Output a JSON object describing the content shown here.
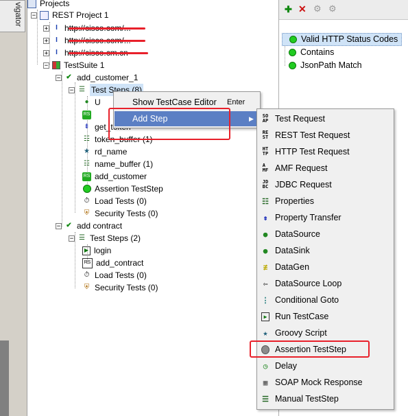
{
  "navigator_label": "vigator",
  "tree": {
    "root": "Projects",
    "project": "REST Project 1",
    "services": [
      "http://cisco.com/...",
      "http://cisco.com/...",
      "http://cisco.cm.cn"
    ],
    "suite": "TestSuite 1",
    "case1": {
      "name": "add_customer_1",
      "steps_label": "Test Steps (8)",
      "steps": [
        "U",
        "",
        "get_token",
        "token_buffer (1)",
        "rd_name",
        "name_buffer (1)",
        "add_customer",
        "Assertion TestStep"
      ],
      "load": "Load Tests (0)",
      "security": "Security Tests (0)"
    },
    "case2": {
      "name": "add contract",
      "steps_label": "Test Steps (2)",
      "steps": [
        "login",
        "add_contract"
      ],
      "load": "Load Tests (0)",
      "security": "Security Tests (0)"
    }
  },
  "context_menu": {
    "items": [
      {
        "label": "Show TestCase Editor",
        "shortcut": "Enter"
      },
      {
        "label": "Add Step",
        "shortcut": ""
      }
    ]
  },
  "submenu": {
    "items": [
      {
        "label": "Test Request",
        "icon": "soap-icon"
      },
      {
        "label": "REST Test Request",
        "icon": "rest-icon"
      },
      {
        "label": "HTTP Test Request",
        "icon": "http-icon"
      },
      {
        "label": "AMF Request",
        "icon": "amf-icon"
      },
      {
        "label": "JDBC Request",
        "icon": "jdbc-icon"
      },
      {
        "label": "Properties",
        "icon": "properties-icon"
      },
      {
        "label": "Property Transfer",
        "icon": "transfer-icon"
      },
      {
        "label": "DataSource",
        "icon": "datasource-icon"
      },
      {
        "label": "DataSink",
        "icon": "datasink-icon"
      },
      {
        "label": "DataGen",
        "icon": "datagen-icon"
      },
      {
        "label": "DataSource Loop",
        "icon": "loop-icon"
      },
      {
        "label": "Conditional Goto",
        "icon": "goto-icon"
      },
      {
        "label": "Run TestCase",
        "icon": "run-icon"
      },
      {
        "label": "Groovy Script",
        "icon": "star-icon"
      },
      {
        "label": "Assertion TestStep",
        "icon": "assertion-icon"
      },
      {
        "label": "Delay",
        "icon": "clock-icon"
      },
      {
        "label": "SOAP Mock Response",
        "icon": "mock-icon"
      },
      {
        "label": "Manual TestStep",
        "icon": "manual-icon"
      }
    ]
  },
  "assertions": {
    "items": [
      "Valid HTTP Status Codes",
      "Contains",
      "JsonPath Match"
    ]
  },
  "colors": {
    "highlight": "#5b7fc4",
    "red_box": "#e8202a",
    "green": "#22cc22"
  }
}
